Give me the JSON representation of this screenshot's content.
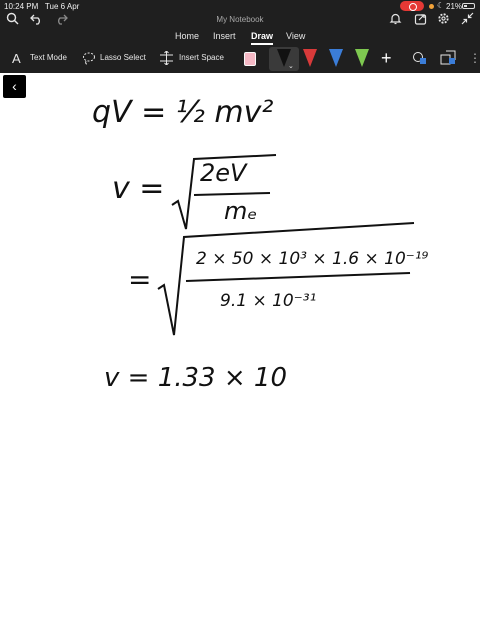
{
  "status": {
    "time": "10:24 PM",
    "date": "Tue 6 Apr",
    "battery": "21%"
  },
  "app": {
    "notebook_title": "My Notebook"
  },
  "tabs": [
    {
      "label": "Home"
    },
    {
      "label": "Insert"
    },
    {
      "label": "Draw"
    },
    {
      "label": "View"
    }
  ],
  "toolbar": {
    "text_mode": "Text Mode",
    "lasso_select": "Lasso Select",
    "insert_space": "Insert Space"
  },
  "colors": {
    "pen_black": "#111111",
    "pen_red": "#d83a3a",
    "pen_blue": "#3b7dd8",
    "pen_green": "#7ec850",
    "recording": "#e53935"
  },
  "handwriting": {
    "line1": "qV = ½ mv²",
    "line2_lhs": "v = ",
    "line2_num": "2eV",
    "line2_den": "mₑ",
    "line3_lhs": "=",
    "line3_num": "2 × 50 × 10³ × 1.6 × 10⁻¹⁹",
    "line3_den": "9.1 × 10⁻³¹",
    "line4": "v = 1.33 × 10"
  }
}
